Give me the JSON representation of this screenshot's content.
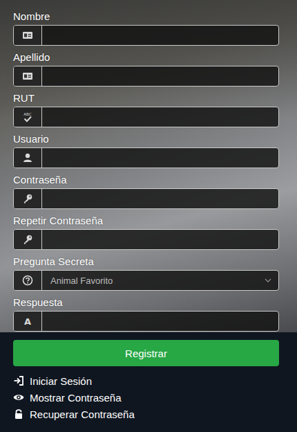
{
  "form": {
    "fields": [
      {
        "label": "Nombre",
        "kind": "input"
      },
      {
        "label": "Apellido",
        "kind": "input"
      },
      {
        "label": "RUT",
        "kind": "input",
        "icon_text": "ABC"
      },
      {
        "label": "Usuario",
        "kind": "input"
      },
      {
        "label": "Contraseña",
        "kind": "input"
      },
      {
        "label": "Repetir Contraseña",
        "kind": "input"
      },
      {
        "label": "Pregunta Secreta",
        "kind": "select",
        "value": "Animal Favorito"
      },
      {
        "label": "Respuesta",
        "kind": "input",
        "icon_text": "A"
      }
    ]
  },
  "button": "Registrar",
  "links": [
    {
      "label": "Iniciar Sesión"
    },
    {
      "label": "Mostrar Contraseña"
    },
    {
      "label": "Recuperar Contraseña"
    }
  ]
}
